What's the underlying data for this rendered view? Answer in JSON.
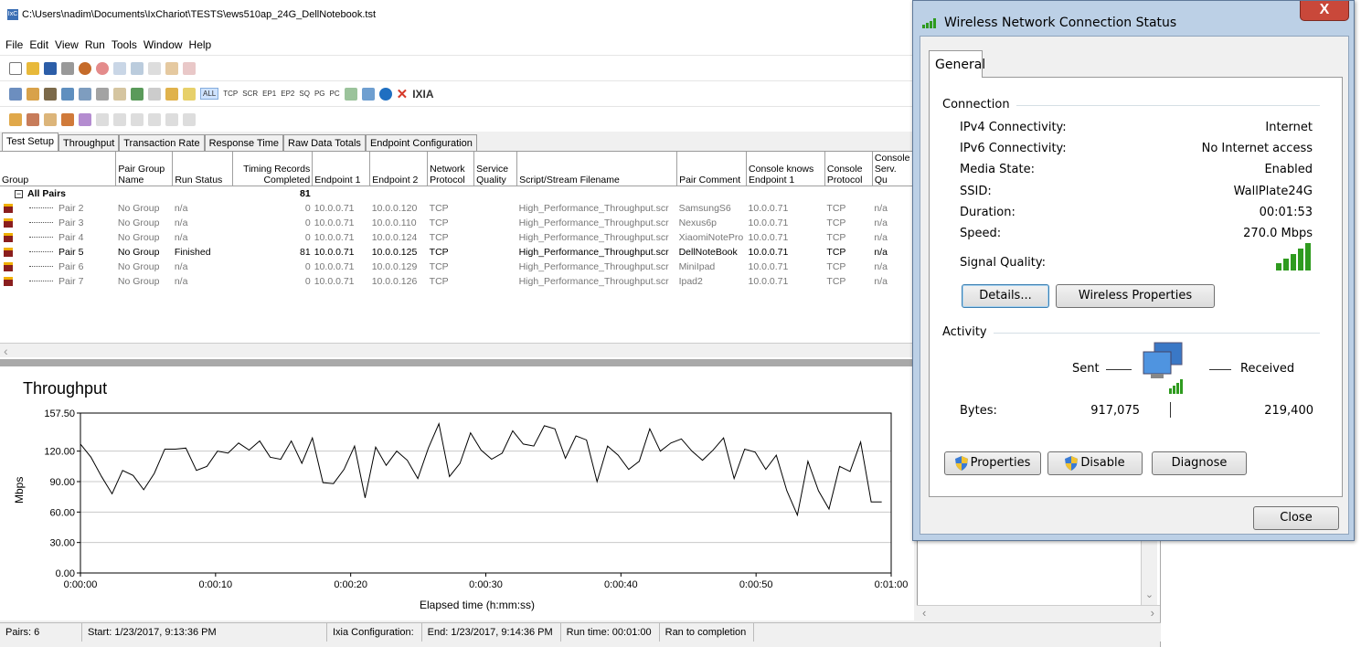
{
  "main_window": {
    "title": "C:\\Users\\nadim\\Documents\\IxChariot\\TESTS\\ews510ap_24G_DellNotebook.tst",
    "menu": [
      "File",
      "Edit",
      "View",
      "Run",
      "Tools",
      "Window",
      "Help"
    ],
    "toolbar2_text": {
      "all": "ALL",
      "tcp": "TCP",
      "scr": "SCR",
      "ep1": "EP1",
      "ep2": "EP2",
      "sq": "SQ",
      "pg": "PG",
      "pc": "PC",
      "brand": "IXIA"
    },
    "tabs": [
      "Test Setup",
      "Throughput",
      "Transaction Rate",
      "Response Time",
      "Raw Data Totals",
      "Endpoint Configuration"
    ],
    "columns": [
      "Group",
      "Pair Group Name",
      "Run Status",
      "Timing Records Completed",
      "Endpoint 1",
      "Endpoint 2",
      "Network Protocol",
      "Service Quality",
      "Script/Stream Filename",
      "Pair Comment",
      "Console knows Endpoint 1",
      "Console Protocol",
      "Console Serv. Qu"
    ],
    "all_pairs": {
      "label": "All Pairs",
      "records": "81"
    },
    "rows": [
      {
        "pair": "Pair 2",
        "group": "No Group",
        "status": "n/a",
        "records": "0",
        "ep1": "10.0.0.71",
        "ep2": "10.0.0.120",
        "proto": "TCP",
        "qos": "",
        "script": "High_Performance_Throughput.scr",
        "comment": "SamsungS6",
        "console_ep1": "10.0.0.71",
        "console_proto": "TCP",
        "console_qos": "n/a",
        "active": false
      },
      {
        "pair": "Pair 3",
        "group": "No Group",
        "status": "n/a",
        "records": "0",
        "ep1": "10.0.0.71",
        "ep2": "10.0.0.110",
        "proto": "TCP",
        "qos": "",
        "script": "High_Performance_Throughput.scr",
        "comment": "Nexus6p",
        "console_ep1": "10.0.0.71",
        "console_proto": "TCP",
        "console_qos": "n/a",
        "active": false
      },
      {
        "pair": "Pair 4",
        "group": "No Group",
        "status": "n/a",
        "records": "0",
        "ep1": "10.0.0.71",
        "ep2": "10.0.0.124",
        "proto": "TCP",
        "qos": "",
        "script": "High_Performance_Throughput.scr",
        "comment": "XiaomiNotePro",
        "console_ep1": "10.0.0.71",
        "console_proto": "TCP",
        "console_qos": "n/a",
        "active": false
      },
      {
        "pair": "Pair 5",
        "group": "No Group",
        "status": "Finished",
        "records": "81",
        "ep1": "10.0.0.71",
        "ep2": "10.0.0.125",
        "proto": "TCP",
        "qos": "",
        "script": "High_Performance_Throughput.scr",
        "comment": "DellNoteBook",
        "console_ep1": "10.0.0.71",
        "console_proto": "TCP",
        "console_qos": "n/a",
        "active": true
      },
      {
        "pair": "Pair 6",
        "group": "No Group",
        "status": "n/a",
        "records": "0",
        "ep1": "10.0.0.71",
        "ep2": "10.0.0.129",
        "proto": "TCP",
        "qos": "",
        "script": "High_Performance_Throughput.scr",
        "comment": "MiniIpad",
        "console_ep1": "10.0.0.71",
        "console_proto": "TCP",
        "console_qos": "n/a",
        "active": false
      },
      {
        "pair": "Pair 7",
        "group": "No Group",
        "status": "n/a",
        "records": "0",
        "ep1": "10.0.0.71",
        "ep2": "10.0.0.126",
        "proto": "TCP",
        "qos": "",
        "script": "High_Performance_Throughput.scr",
        "comment": "Ipad2",
        "console_ep1": "10.0.0.71",
        "console_proto": "TCP",
        "console_qos": "n/a",
        "active": false
      }
    ],
    "status_bar": [
      "Pairs: 6",
      "Start: 1/23/2017, 9:13:36 PM",
      "Ixia Configuration:",
      "End: 1/23/2017, 9:14:36 PM",
      "Run time: 00:01:00",
      "Ran to completion"
    ]
  },
  "chart_data": {
    "type": "line",
    "title": "Throughput",
    "xlabel": "Elapsed time (h:mm:ss)",
    "ylabel": "Mbps",
    "ylim": [
      0,
      157.5
    ],
    "xlim": [
      0,
      60
    ],
    "yticks": [
      "0.00",
      "30.00",
      "60.00",
      "90.00",
      "120.00",
      "157.50"
    ],
    "ytick_values": [
      0,
      30,
      60,
      90,
      120,
      157.5
    ],
    "xticks": [
      "0:00:00",
      "0:00:10",
      "0:00:20",
      "0:00:30",
      "0:00:40",
      "0:00:50",
      "0:01:00"
    ],
    "grid": true,
    "color": "#000000",
    "x": [
      0,
      0.9,
      1.7,
      2.6,
      3.5,
      4.3,
      5.2,
      6.0,
      6.9,
      7.8,
      8.6,
      9.5,
      10.3,
      11.2,
      12.1,
      12.9,
      13.8,
      14.6,
      15.5,
      16.4,
      17.2,
      18.1,
      18.9,
      19.8,
      20.7,
      21.5,
      22.4,
      23.2,
      24.1,
      25.0,
      25.8,
      26.7,
      27.5,
      28.4,
      29.3,
      30.1,
      31.0,
      31.8,
      32.7,
      33.6,
      34.4,
      35.3,
      36.1,
      37.0,
      37.8,
      38.7,
      39.6,
      40.4,
      41.3,
      42.1,
      43.0,
      43.9,
      44.7,
      45.6,
      46.4,
      47.3,
      48.2,
      49.0,
      49.9,
      50.7,
      51.6,
      52.5,
      53.3,
      54.2,
      55.0,
      55.9,
      56.8,
      57.6,
      58.5,
      59.3
    ],
    "values": [
      127,
      114,
      95,
      78,
      101,
      96,
      82,
      98,
      122,
      122,
      123,
      101,
      105,
      120,
      118,
      128,
      121,
      130,
      114,
      112,
      130,
      108,
      133,
      89,
      88,
      102,
      125,
      74,
      124,
      106,
      120,
      111,
      93,
      123,
      147,
      95,
      108,
      138,
      121,
      112,
      118,
      140,
      127,
      125,
      145,
      142,
      113,
      135,
      131,
      90,
      125,
      116,
      102,
      110,
      142,
      120,
      128,
      132,
      120,
      111,
      121,
      133,
      93,
      122,
      119,
      102,
      116,
      81,
      57,
      110,
      81,
      63,
      105,
      100,
      129,
      70,
      70
    ]
  },
  "dialog": {
    "title": "Wireless Network Connection Status",
    "close_x": "X",
    "tab": "General",
    "connection_label": "Connection",
    "rows": [
      {
        "label": "IPv4 Connectivity:",
        "value": "Internet"
      },
      {
        "label": "IPv6 Connectivity:",
        "value": "No Internet access"
      },
      {
        "label": "Media State:",
        "value": "Enabled"
      },
      {
        "label": "SSID:",
        "value": "WallPlate24G"
      },
      {
        "label": "Duration:",
        "value": "00:01:53"
      },
      {
        "label": "Speed:",
        "value": "270.0 Mbps"
      }
    ],
    "signal_label": "Signal Quality:",
    "details_button": "Details...",
    "wireless_props_button": "Wireless Properties",
    "activity_label": "Activity",
    "sent_label": "Sent",
    "received_label": "Received",
    "bytes_label": "Bytes:",
    "bytes_sent": "917,075",
    "bytes_received": "219,400",
    "properties_button": "Properties",
    "disable_button": "Disable",
    "diagnose_button": "Diagnose",
    "close_button": "Close",
    "signal_color": "#2f9b1f"
  }
}
